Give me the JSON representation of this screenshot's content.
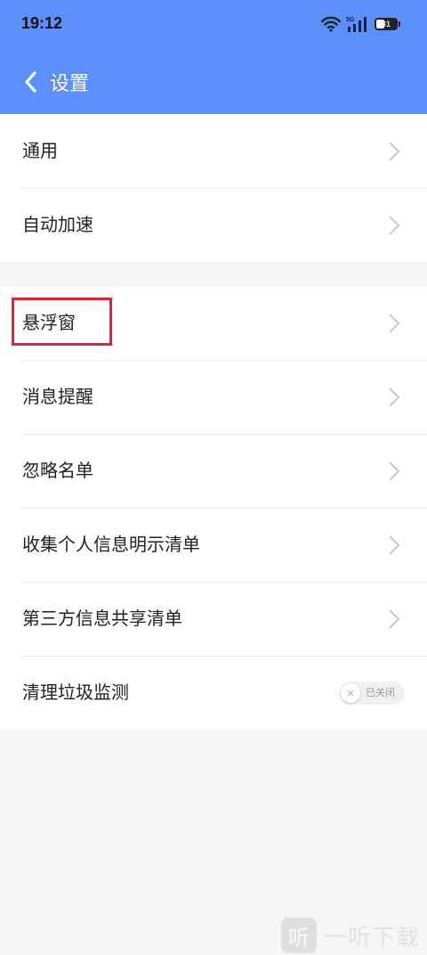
{
  "status_bar": {
    "time": "19:12",
    "network": "5G",
    "battery": "31",
    "icons": [
      "wifi-icon",
      "signal-icon",
      "battery-icon"
    ]
  },
  "nav": {
    "back_icon": "chevron-left-icon",
    "title": "设置"
  },
  "group1": [
    {
      "label": "通用"
    },
    {
      "label": "自动加速"
    }
  ],
  "group2": [
    {
      "label": "悬浮窗",
      "highlighted": true
    },
    {
      "label": "消息提醒"
    },
    {
      "label": "忽略名单"
    },
    {
      "label": "收集个人信息明示清单"
    },
    {
      "label": "第三方信息共享清单"
    },
    {
      "label": "清理垃圾监测",
      "toggle": {
        "state_label": "已关闭",
        "on": false
      }
    }
  ],
  "watermark": {
    "logo_char": "听",
    "text": "一听下载"
  },
  "colors": {
    "header": "#5b8ff9",
    "background": "#f5f6f8",
    "highlight": "#e8202a"
  }
}
